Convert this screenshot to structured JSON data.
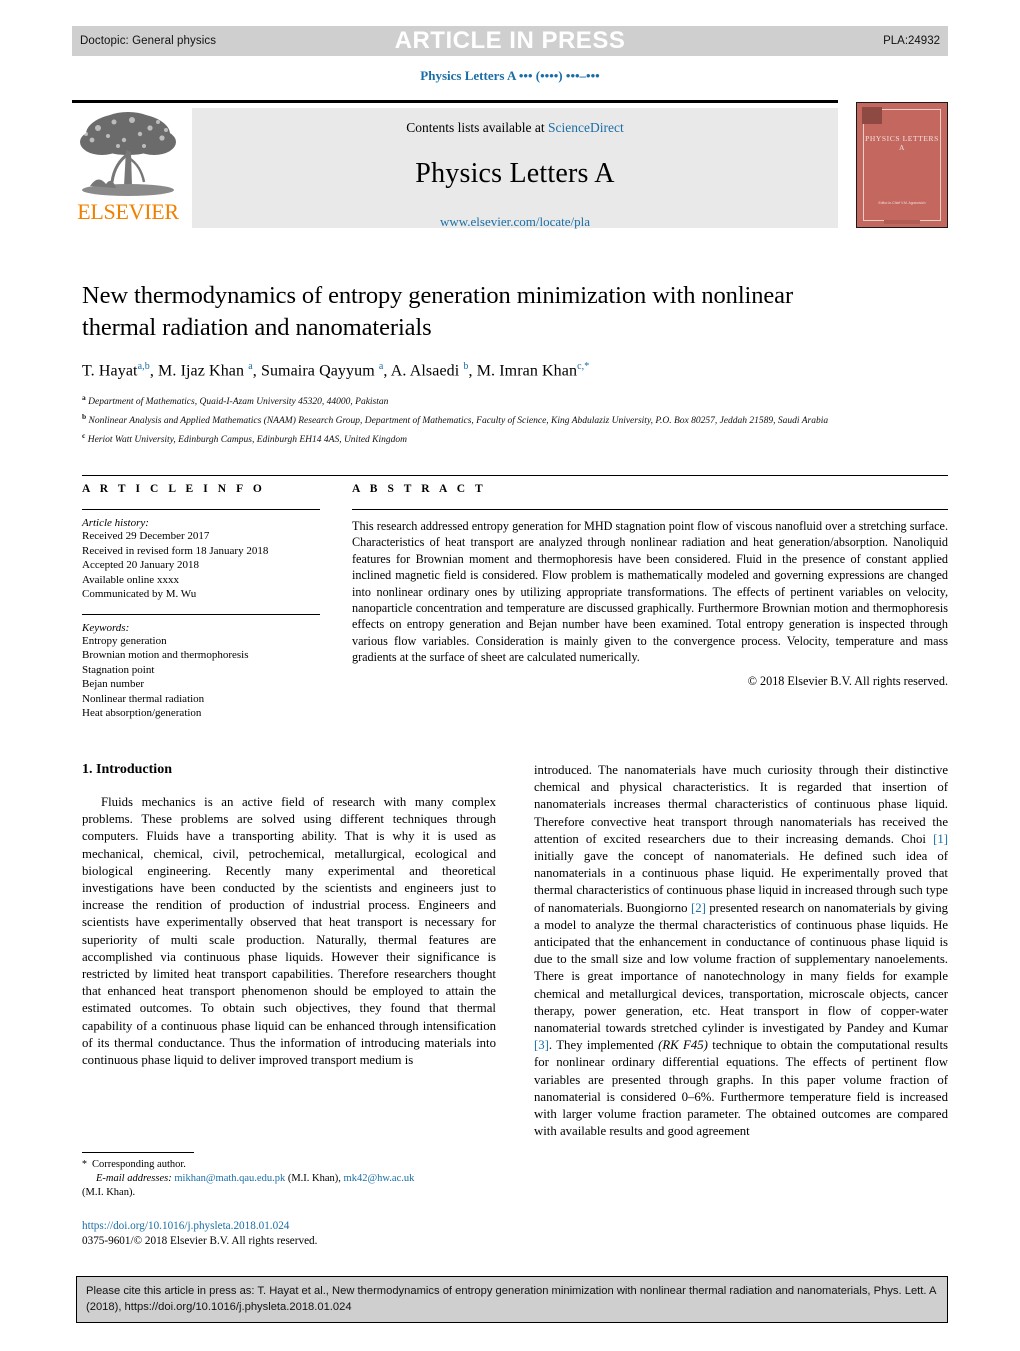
{
  "header": {
    "doctopic": "Doctopic: General physics",
    "stamp": "ARTICLE IN PRESS",
    "article_id": "PLA:24932",
    "running_head": "Physics Letters A ••• (••••) •••–•••"
  },
  "masthead": {
    "contents_prefix": "Contents lists available at ",
    "contents_link": "ScienceDirect",
    "journal_title": "Physics Letters A",
    "journal_url": "www.elsevier.com/locate/pla",
    "publisher": "ELSEVIER",
    "cover_title": "PHYSICS LETTERS A",
    "cover_footer": "Editor-in-Chief\nV.M. Agranovich"
  },
  "article": {
    "title": "New thermodynamics of entropy generation minimization with nonlinear thermal radiation and nanomaterials",
    "authors_html": "T. Hayat<sup>a,b</sup>, M. Ijaz Khan <sup>a</sup>, Sumaira Qayyum <sup>a</sup>, A. Alsaedi <sup>b</sup>, M. Imran Khan<sup>c,<span class=\"star\">*</span></sup>",
    "affiliations": [
      {
        "mark": "a",
        "text": "Department of Mathematics, Quaid-I-Azam University 45320, 44000, Pakistan"
      },
      {
        "mark": "b",
        "text": "Nonlinear Analysis and Applied Mathematics (NAAM) Research Group, Department of Mathematics, Faculty of Science, King Abdulaziz University, P.O. Box 80257, Jeddah 21589, Saudi Arabia"
      },
      {
        "mark": "c",
        "text": "Heriot Watt University, Edinburgh Campus, Edinburgh EH14 4AS, United Kingdom"
      }
    ]
  },
  "info": {
    "label": "A R T I C L E   I N F O",
    "history_head": "Article history:",
    "history": [
      "Received 29 December 2017",
      "Received in revised form 18 January 2018",
      "Accepted 20 January 2018",
      "Available online xxxx",
      "Communicated by M. Wu"
    ],
    "keywords_head": "Keywords:",
    "keywords": [
      "Entropy generation",
      "Brownian motion and thermophoresis",
      "Stagnation point",
      "Bejan number",
      "Nonlinear thermal radiation",
      "Heat absorption/generation"
    ]
  },
  "abstract": {
    "label": "A B S T R A C T",
    "text": "This research addressed entropy generation for MHD stagnation point flow of viscous nanofluid over a stretching surface. Characteristics of heat transport are analyzed through nonlinear radiation and heat generation/absorption. Nanoliquid features for Brownian moment and thermophoresis have been considered. Fluid in the presence of constant applied inclined magnetic field is considered. Flow problem is mathematically modeled and governing expressions are changed into nonlinear ordinary ones by utilizing appropriate transformations. The effects of pertinent variables on velocity, nanoparticle concentration and temperature are discussed graphically. Furthermore Brownian motion and thermophoresis effects on entropy generation and Bejan number have been examined. Total entropy generation is inspected through various flow variables. Consideration is mainly given to the convergence process. Velocity, temperature and mass gradients at the surface of sheet are calculated numerically.",
    "copyright": "© 2018 Elsevier B.V. All rights reserved."
  },
  "body": {
    "section_heading": "1. Introduction",
    "left_paragraph": "Fluids mechanics is an active field of research with many complex problems. These problems are solved using different techniques through computers. Fluids have a transporting ability. That is why it is used as mechanical, chemical, civil, petrochemical, metallurgical, ecological and biological engineering. Recently many experimental and theoretical investigations have been conducted by the scientists and engineers just to increase the rendition of production of industrial process. Engineers and scientists have experimentally observed that heat transport is necessary for superiority of multi scale production. Naturally, thermal features are accomplished via continuous phase liquids. However their significance is restricted by limited heat transport capabilities. Therefore researchers thought that enhanced heat transport phenomenon should be employed to attain the estimated outcomes. To obtain such objectives, they found that thermal capability of a continuous phase liquid can be enhanced through intensification of its thermal conductance. Thus the information of introducing materials into continuous phase liquid to deliver improved transport medium is",
    "right_paragraph_html": "introduced. The nanomaterials have much curiosity through their distinctive chemical and physical characteristics. It is regarded that insertion of nanomaterials increases thermal characteristics of continuous phase liquid. Therefore convective heat transport through nanomaterials has received the attention of excited researchers due to their increasing demands. Choi <span class=\"ref\">[1]</span> initially gave the concept of nanomaterials. He defined such idea of nanomaterials in a continuous phase liquid. He experimentally proved that thermal characteristics of continuous phase liquid in increased through such type of nanomaterials. Buongiorno <span class=\"ref\">[2]</span> presented research on nanomaterials by giving a model to analyze the thermal characteristics of continuous phase liquids. He anticipated that the enhancement in conductance of continuous phase liquid is due to the small size and low volume fraction of supplementary nanoelements. There is great importance of nanotechnology in many fields for example chemical and metallurgical devices, transportation, microscale objects, cancer therapy, power generation, etc. Heat transport in flow of copper-water nanomaterial towards stretched cylinder is investigated by Pandey and Kumar <span class=\"ref\">[3]</span>. They implemented <i>(RK F45)</i> technique to obtain the computational results for nonlinear ordinary differential equations. The effects of pertinent flow variables are presented through graphs. In this paper volume fraction of nanomaterial is considered 0&ndash;6%. Furthermore temperature field is increased with larger volume fraction parameter. The obtained outcomes are compared with available results and good agreement"
  },
  "footnotes": {
    "corresponding": "Corresponding author.",
    "email_label": "E-mail addresses:",
    "email1": "mikhan@math.qau.edu.pk",
    "email1_owner": "(M.I. Khan),",
    "email2": "mk42@hw.ac.uk",
    "email2_owner": "(M.I. Khan).",
    "doi": "https://doi.org/10.1016/j.physleta.2018.01.024",
    "issn": "0375-9601/© 2018 Elsevier B.V. All rights reserved."
  },
  "citation": {
    "text": "Please cite this article in press as: T. Hayat et al., New thermodynamics of entropy generation minimization with nonlinear thermal radiation and nanomaterials, Phys. Lett. A (2018), https://doi.org/10.1016/j.physleta.2018.01.024"
  },
  "colors": {
    "link": "#1a6ea5",
    "banner_bg": "#cfcfcf",
    "panel_bg": "#e9e9e9",
    "elsevier_orange": "#f08000",
    "cover_red": "#c4685f"
  }
}
